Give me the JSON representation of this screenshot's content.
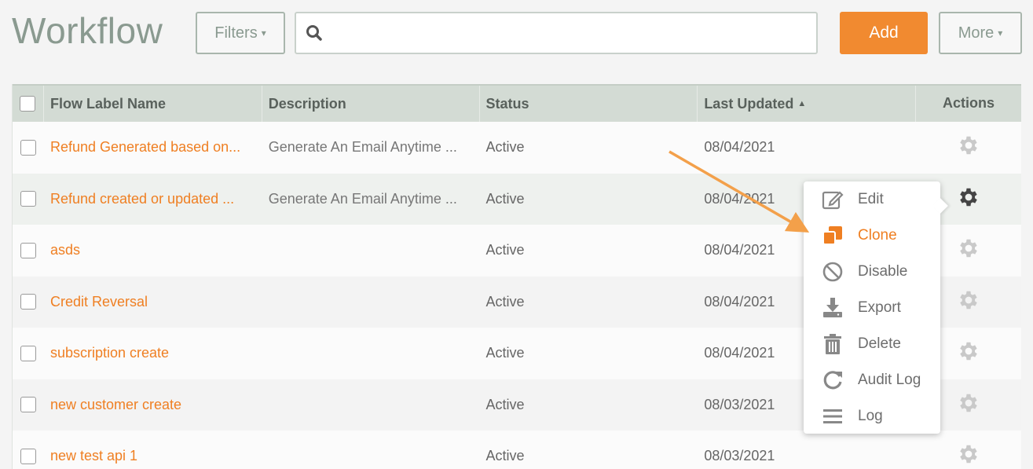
{
  "page": {
    "title": "Workflow"
  },
  "toolbar": {
    "filters_label": "Filters",
    "search_value": "",
    "search_placeholder": "",
    "add_label": "Add",
    "more_label": "More"
  },
  "table": {
    "columns": {
      "name": "Flow Label Name",
      "description": "Description",
      "status": "Status",
      "last_updated": "Last Updated",
      "actions": "Actions"
    },
    "sort": {
      "column": "last_updated",
      "direction": "ascending"
    },
    "rows": [
      {
        "name": "Refund Generated based on...",
        "description": "Generate An Email Anytime ...",
        "status": "Active",
        "last_updated": "08/04/2021"
      },
      {
        "name": "Refund created or updated ...",
        "description": "Generate An Email Anytime ...",
        "status": "Active",
        "last_updated": "08/04/2021"
      },
      {
        "name": "asds",
        "description": "",
        "status": "Active",
        "last_updated": "08/04/2021"
      },
      {
        "name": "Credit Reversal",
        "description": "",
        "status": "Active",
        "last_updated": "08/04/2021"
      },
      {
        "name": "subscription create",
        "description": "",
        "status": "Active",
        "last_updated": "08/04/2021"
      },
      {
        "name": "new customer create",
        "description": "",
        "status": "Active",
        "last_updated": "08/03/2021"
      },
      {
        "name": "new test api 1",
        "description": "",
        "status": "Active",
        "last_updated": "08/03/2021"
      }
    ]
  },
  "actions_menu": {
    "open_for_row": 2,
    "items": [
      {
        "label": "Edit",
        "icon": "edit-icon"
      },
      {
        "label": "Clone",
        "icon": "clone-icon",
        "highlighted": true
      },
      {
        "label": "Disable",
        "icon": "disable-icon"
      },
      {
        "label": "Export",
        "icon": "export-icon"
      },
      {
        "label": "Delete",
        "icon": "trash-icon"
      },
      {
        "label": "Audit Log",
        "icon": "refresh-icon"
      },
      {
        "label": "Log",
        "icon": "list-icon"
      }
    ]
  },
  "colors": {
    "accent": "#f18a30",
    "link": "#ef7f22",
    "header_bg": "#d3dbd4",
    "title": "#8a9a90"
  }
}
